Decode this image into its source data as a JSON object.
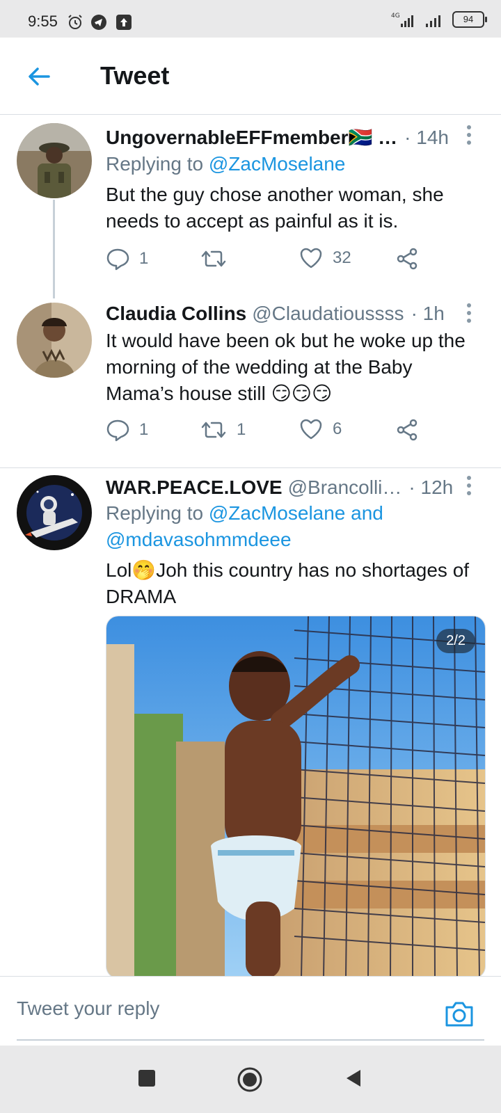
{
  "status_bar": {
    "time": "9:55",
    "battery": "94",
    "network": "4G"
  },
  "header": {
    "title": "Tweet"
  },
  "tweets": [
    {
      "name": "UngovernableEFFmember🇿🇦 …",
      "handle": "",
      "time": "· 14h",
      "replying_prefix": "Replying to ",
      "replying_to": "@ZacMoselane",
      "text": "But the guy chose another woman, she needs to accept as painful as it is.",
      "replies": "1",
      "retweets": "",
      "likes": "32"
    },
    {
      "name": "Claudia Collins",
      "handle": "@Claudatioussss",
      "time": "· 1h",
      "text": "It would have been ok but he woke up the morning of the wedding at the Baby Mama’s house still 😏😏😏",
      "replies": "1",
      "retweets": "1",
      "likes": "6"
    },
    {
      "name": "WAR.PEACE.LOVE",
      "handle": "@Brancolli…",
      "time": "· 12h",
      "replying_prefix": "Replying to ",
      "replying_to": "@ZacMoselane and @mdavasohmmdeee",
      "text": "Lol🤭Joh this country has no shortages of DRAMA",
      "media_badge": "2/2"
    }
  ],
  "reply_bar": {
    "placeholder": "Tweet your reply"
  },
  "colors": {
    "accent": "#1b95e0",
    "secondary_text": "#657786"
  }
}
